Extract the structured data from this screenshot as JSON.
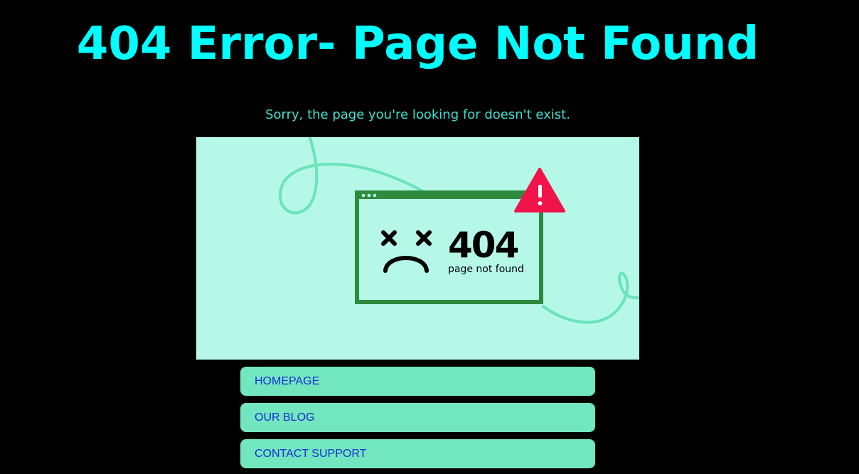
{
  "page": {
    "title": "404 Error- Page Not Found",
    "subtitle": "Sorry, the page you're looking for doesn't exist."
  },
  "illustration": {
    "code": "404",
    "caption": "page not found",
    "warning_icon": "warning-triangle-icon",
    "face_icon": "sad-face-icon",
    "colors": {
      "background": "#b6f8e7",
      "window_frame": "#2e8b3e",
      "squiggle": "#6be3b8",
      "warning": "#f0144a"
    }
  },
  "nav": {
    "items": [
      {
        "label": "HOMEPAGE"
      },
      {
        "label": "OUR BLOG"
      },
      {
        "label": "CONTACT SUPPORT"
      }
    ]
  },
  "colors": {
    "background": "#000000",
    "title": "#00ffff",
    "subtitle": "#40e0d0",
    "button_bg": "#72e6bf",
    "button_text": "#1a2fd6"
  }
}
